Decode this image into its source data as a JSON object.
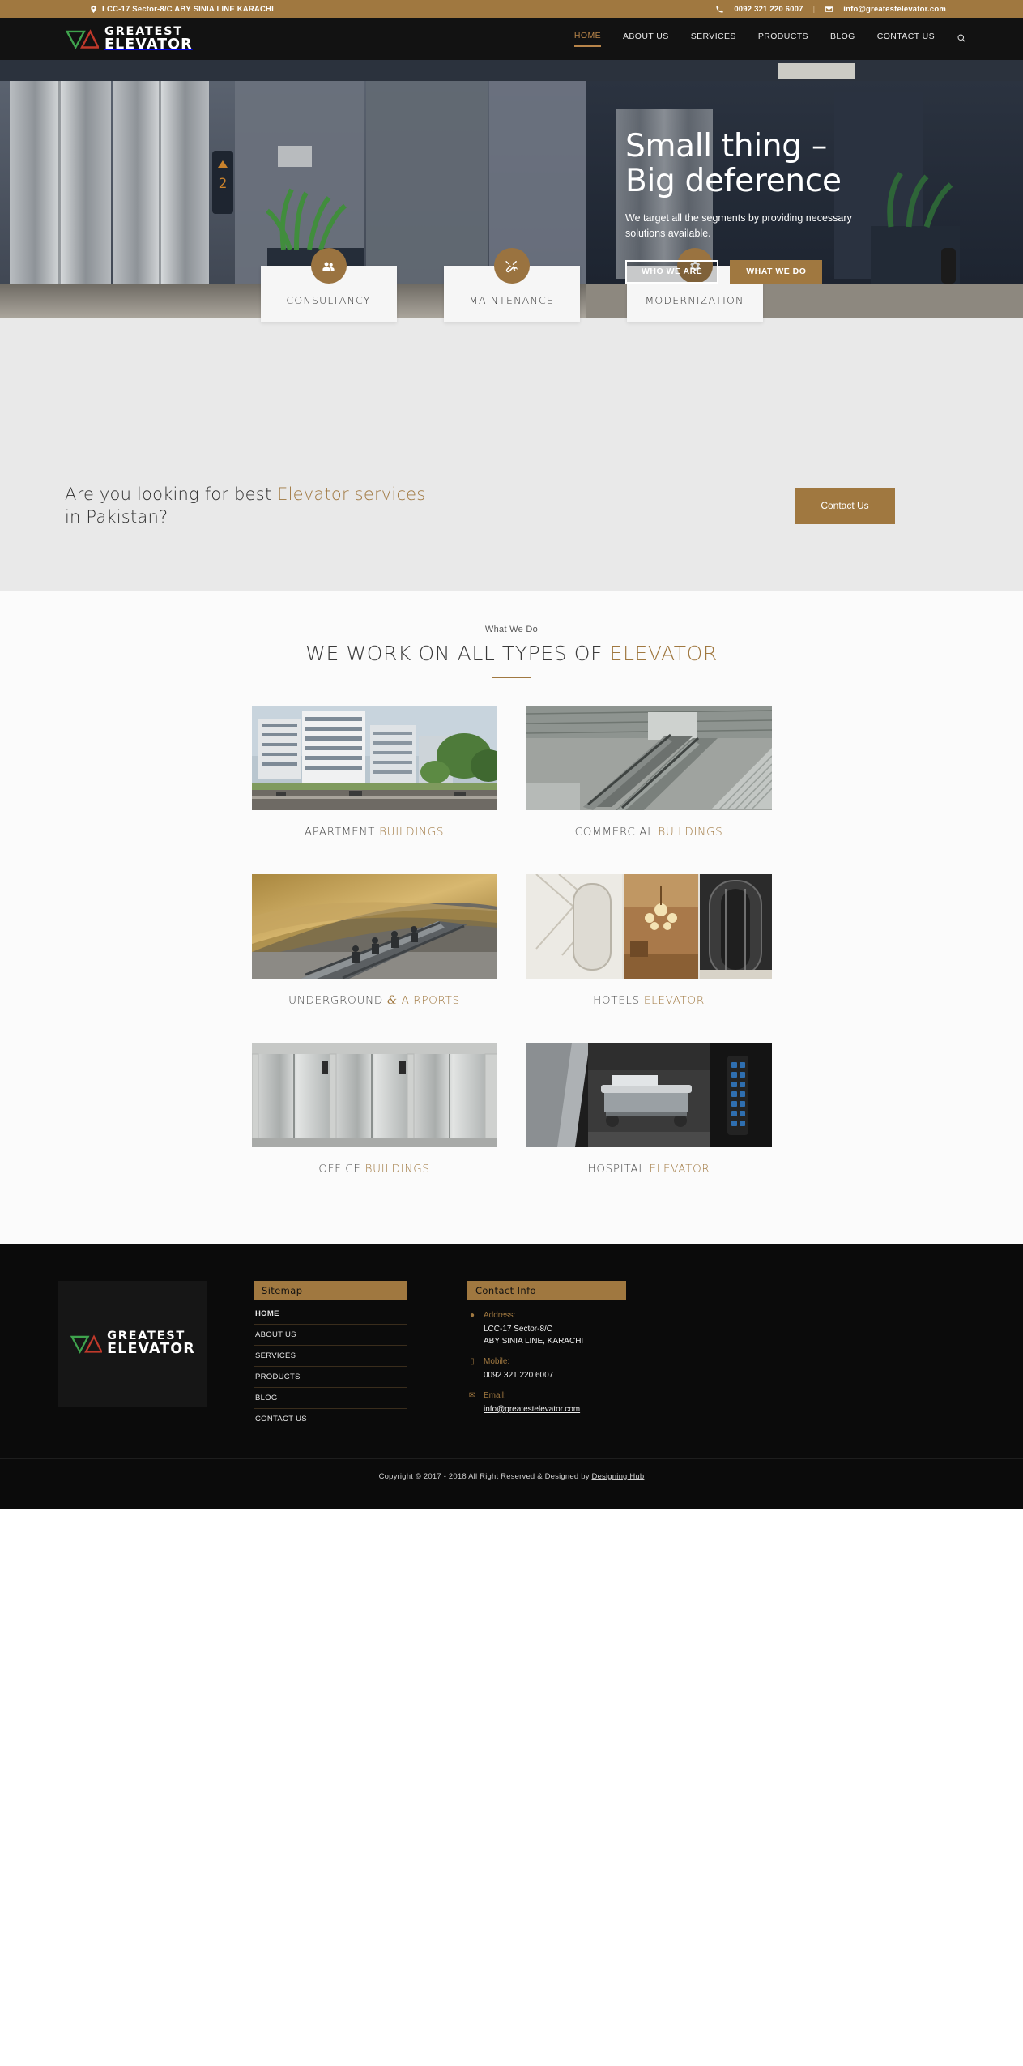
{
  "topbar": {
    "address_icon": "location-pin-icon",
    "address": "LCC-17 Sector-8/C ABY SINIA LINE KARACHI",
    "phone_icon": "phone-icon",
    "phone": "0092 321 220 6007",
    "email_icon": "envelope-icon",
    "email": "info@greatestelevator.com",
    "separator": "|"
  },
  "header": {
    "logo": {
      "line1": "GREATEST",
      "line2": "ELEVATOR",
      "mark": "triangles-logo-icon"
    },
    "nav": [
      {
        "label": "HOME",
        "active": true
      },
      {
        "label": "ABOUT US",
        "active": false
      },
      {
        "label": "SERVICES",
        "active": false
      },
      {
        "label": "PRODUCTS",
        "active": false
      },
      {
        "label": "BLOG",
        "active": false
      },
      {
        "label": "CONTACT US",
        "active": false
      }
    ],
    "search_icon": "search-icon"
  },
  "hero": {
    "title_line1": "Small thing –",
    "title_line2": "Big deference",
    "subtitle": "We target all the segments by providing necessary solutions available.",
    "btn_primary": "WHO WE ARE",
    "btn_secondary": "WHAT WE DO"
  },
  "service_cards": [
    {
      "label": "CONSULTANCY",
      "icon": "users-icon"
    },
    {
      "label": "MAINTENANCE",
      "icon": "tools-icon"
    },
    {
      "label": "MODERNIZATION",
      "icon": "gear-icon"
    }
  ],
  "cta": {
    "text_before": "Are you looking for best ",
    "text_highlight": "Elevator services",
    "text_after": " in Pakistan?",
    "button": "Contact Us"
  },
  "work": {
    "eyebrow": "What We Do",
    "title_before": "WE WORK ON ALL TYPES OF ",
    "title_highlight": "ELEVATOR",
    "tiles": [
      {
        "plain": "APARTMENT ",
        "sep": "",
        "highlight": "BUILDINGS",
        "image": "apartment-buildings-photo"
      },
      {
        "plain": "COMMERCIAL ",
        "sep": "",
        "highlight": "BUILDINGS",
        "image": "commercial-buildings-photo"
      },
      {
        "plain": "UNDERGROUND ",
        "sep": "&",
        "highlight": " AIRPORTS",
        "image": "underground-airports-photo"
      },
      {
        "plain": "HOTELS ",
        "sep": "",
        "highlight": "ELEVATOR",
        "image": "hotels-elevator-photo"
      },
      {
        "plain": "OFFICE ",
        "sep": "",
        "highlight": "BUILDINGS",
        "image": "office-buildings-photo"
      },
      {
        "plain": "HOSPITAL ",
        "sep": "",
        "highlight": "ELEVATOR",
        "image": "hospital-elevator-photo"
      }
    ]
  },
  "footer": {
    "logo": {
      "line1": "GREATEST",
      "line2": "ELEVATOR",
      "mark": "triangles-logo-icon"
    },
    "sitemap": {
      "heading": "Sitemap",
      "items": [
        {
          "label": "HOME",
          "active": true
        },
        {
          "label": "ABOUT US",
          "active": false
        },
        {
          "label": "SERVICES",
          "active": false
        },
        {
          "label": "PRODUCTS",
          "active": false
        },
        {
          "label": "BLOG",
          "active": false
        },
        {
          "label": "CONTACT US",
          "active": false
        }
      ]
    },
    "contact": {
      "heading": "Contact Info",
      "address_label": "Address:",
      "address_icon": "location-pin-icon",
      "address_line1": "LCC-17 Sector-8/C",
      "address_line2": "ABY SINIA LINE, KARACHI",
      "mobile_label": "Mobile:",
      "mobile_icon": "mobile-phone-icon",
      "mobile_value": "0092 321 220 6007",
      "email_label": "Email:",
      "email_icon": "envelope-icon",
      "email_value": "info@greatestelevator.com"
    },
    "copyright_text": "Copyright © 2017 - 2018 All Right Reserved & Designed by ",
    "copyright_link": "Designing Hub"
  },
  "colors": {
    "brand_gold": "#a07840",
    "header_dark": "#121212",
    "band_grey": "#e9e9e9",
    "footer_black": "#0b0b0b"
  }
}
